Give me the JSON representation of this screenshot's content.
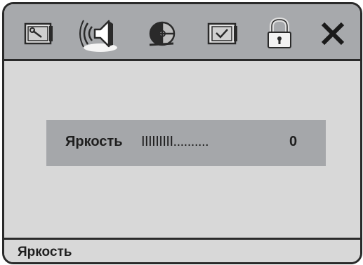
{
  "toolbar": {
    "items": [
      {
        "icon": "tools-monitor-icon"
      },
      {
        "icon": "speaker-sound-icon"
      },
      {
        "icon": "film-reel-icon"
      },
      {
        "icon": "checkbox-monitor-icon"
      },
      {
        "icon": "lock-icon"
      },
      {
        "icon": "close-icon"
      }
    ],
    "selected_index": 1
  },
  "setting": {
    "label": "Яркость",
    "bar_text": "IIIIIIIII..........",
    "value": "0"
  },
  "status": {
    "text": "Яркость"
  },
  "colors": {
    "toolbar_bg": "#a7a9ac",
    "panel_bg": "#d8d8d8",
    "row_bg": "#a5a7aa",
    "border": "#2a2a2a"
  }
}
